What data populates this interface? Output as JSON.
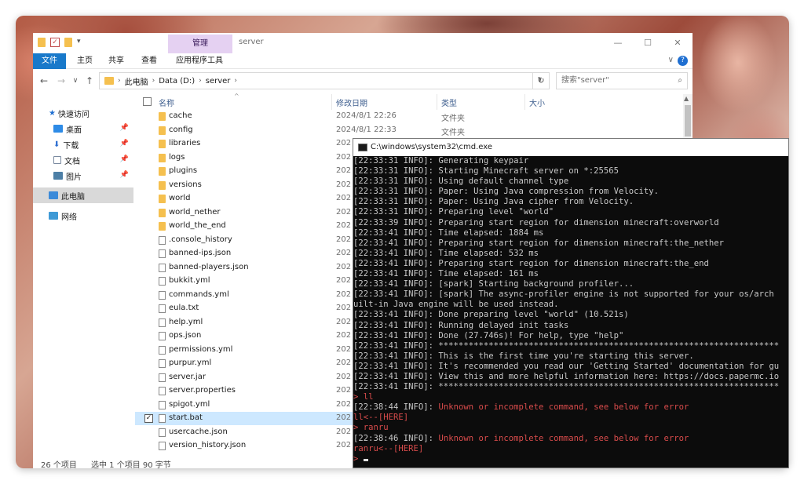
{
  "explorer": {
    "ribbon_context_tab": "管理",
    "window_title": "server",
    "ribbon_tabs": [
      "文件",
      "主页",
      "共享",
      "查看",
      "应用程序工具"
    ],
    "address": {
      "crumbs": [
        "此电脑",
        "Data (D:)",
        "server"
      ]
    },
    "search_placeholder": "搜索\"server\"",
    "nav": {
      "quick_access": "快速访问",
      "desktop": "桌面",
      "downloads": "下载",
      "documents": "文档",
      "pictures": "图片",
      "this_pc": "此电脑",
      "network": "网络"
    },
    "columns": {
      "name": "名称",
      "date": "修改日期",
      "type": "类型",
      "size": "大小"
    },
    "files": [
      {
        "name": "cache",
        "kind": "folder",
        "date": "2024/8/1 22:26",
        "type": "文件夹"
      },
      {
        "name": "config",
        "kind": "folder",
        "date": "2024/8/1 22:33",
        "type": "文件夹"
      },
      {
        "name": "libraries",
        "kind": "folder",
        "date": "202",
        "type": ""
      },
      {
        "name": "logs",
        "kind": "folder",
        "date": "202",
        "type": ""
      },
      {
        "name": "plugins",
        "kind": "folder",
        "date": "202",
        "type": ""
      },
      {
        "name": "versions",
        "kind": "folder",
        "date": "202",
        "type": ""
      },
      {
        "name": "world",
        "kind": "folder",
        "date": "202",
        "type": ""
      },
      {
        "name": "world_nether",
        "kind": "folder",
        "date": "202",
        "type": ""
      },
      {
        "name": "world_the_end",
        "kind": "folder",
        "date": "202",
        "type": ""
      },
      {
        "name": ".console_history",
        "kind": "file",
        "date": "202",
        "type": ""
      },
      {
        "name": "banned-ips.json",
        "kind": "file",
        "date": "202",
        "type": ""
      },
      {
        "name": "banned-players.json",
        "kind": "file",
        "date": "202",
        "type": ""
      },
      {
        "name": "bukkit.yml",
        "kind": "file",
        "date": "202",
        "type": ""
      },
      {
        "name": "commands.yml",
        "kind": "file",
        "date": "202",
        "type": ""
      },
      {
        "name": "eula.txt",
        "kind": "file",
        "date": "202",
        "type": ""
      },
      {
        "name": "help.yml",
        "kind": "file",
        "date": "202",
        "type": ""
      },
      {
        "name": "ops.json",
        "kind": "file",
        "date": "202",
        "type": ""
      },
      {
        "name": "permissions.yml",
        "kind": "file",
        "date": "202",
        "type": ""
      },
      {
        "name": "purpur.yml",
        "kind": "file",
        "date": "202",
        "type": ""
      },
      {
        "name": "server.jar",
        "kind": "file",
        "date": "202",
        "type": ""
      },
      {
        "name": "server.properties",
        "kind": "file",
        "date": "202",
        "type": ""
      },
      {
        "name": "spigot.yml",
        "kind": "file",
        "date": "202",
        "type": ""
      },
      {
        "name": "start.bat",
        "kind": "file",
        "date": "202",
        "type": "",
        "selected": true
      },
      {
        "name": "usercache.json",
        "kind": "file",
        "date": "202",
        "type": ""
      },
      {
        "name": "version_history.json",
        "kind": "file",
        "date": "202",
        "type": ""
      }
    ],
    "status": {
      "count": "26 个项目",
      "selection": "选中 1 个项目  90 字节"
    }
  },
  "cmd": {
    "title": "C:\\windows\\system32\\cmd.exe",
    "lines": [
      {
        "text": "[22:33:31 INFO]: Generating keypair",
        "color": "gray"
      },
      {
        "text": "[22:33:31 INFO]: Starting Minecraft server on *:25565",
        "color": "gray"
      },
      {
        "text": "[22:33:31 INFO]: Using default channel type",
        "color": "gray"
      },
      {
        "text": "[22:33:31 INFO]: Paper: Using Java compression from Velocity.",
        "color": "gray"
      },
      {
        "text": "[22:33:31 INFO]: Paper: Using Java cipher from Velocity.",
        "color": "gray"
      },
      {
        "text": "[22:33:31 INFO]: Preparing level \"world\"",
        "color": "gray"
      },
      {
        "text": "[22:33:39 INFO]: Preparing start region for dimension minecraft:overworld",
        "color": "gray"
      },
      {
        "text": "[22:33:41 INFO]: Time elapsed: 1884 ms",
        "color": "gray"
      },
      {
        "text": "[22:33:41 INFO]: Preparing start region for dimension minecraft:the_nether",
        "color": "gray"
      },
      {
        "text": "[22:33:41 INFO]: Time elapsed: 532 ms",
        "color": "gray"
      },
      {
        "text": "[22:33:41 INFO]: Preparing start region for dimension minecraft:the_end",
        "color": "gray"
      },
      {
        "text": "[22:33:41 INFO]: Time elapsed: 161 ms",
        "color": "gray"
      },
      {
        "text": "[22:33:41 INFO]: [spark] Starting background profiler...",
        "color": "gray"
      },
      {
        "text": "[22:33:41 INFO]: [spark] The async-profiler engine is not supported for your os/arch",
        "color": "gray"
      },
      {
        "text": "uilt-in Java engine will be used instead.",
        "color": "gray"
      },
      {
        "text": "[22:33:41 INFO]: Done preparing level \"world\" (10.521s)",
        "color": "gray"
      },
      {
        "text": "[22:33:41 INFO]: Running delayed init tasks",
        "color": "gray"
      },
      {
        "text": "[22:33:41 INFO]: Done (27.746s)! For help, type \"help\"",
        "color": "gray"
      },
      {
        "text": "[22:33:41 INFO]: ********************************************************************",
        "color": "gray"
      },
      {
        "text": "[22:33:41 INFO]: This is the first time you're starting this server.",
        "color": "gray"
      },
      {
        "text": "[22:33:41 INFO]: It's recommended you read our 'Getting Started' documentation for gu",
        "color": "gray"
      },
      {
        "text": "[22:33:41 INFO]: View this and more helpful information here: https://docs.papermc.io",
        "color": "gray"
      },
      {
        "text": "[22:33:41 INFO]: ********************************************************************",
        "color": "gray"
      },
      {
        "text": "> ll",
        "color": "red"
      },
      {
        "text": "[22:38:44 INFO]: Unknown or incomplete command, see below for error",
        "color": "mixed"
      },
      {
        "text": "ll<--[HERE]",
        "color": "red"
      },
      {
        "text": "> ranru",
        "color": "red"
      },
      {
        "text": "[22:38:46 INFO]: Unknown or incomplete command, see below for error",
        "color": "mixed"
      },
      {
        "text": "ranru<--[HERE]",
        "color": "red"
      },
      {
        "text": "> ",
        "color": "prompt"
      }
    ]
  }
}
